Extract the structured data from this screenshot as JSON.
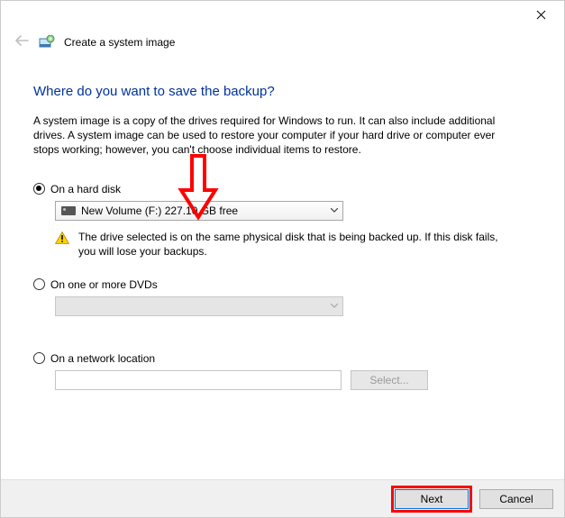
{
  "window": {
    "title": "Create a system image"
  },
  "heading": "Where do you want to save the backup?",
  "description": "A system image is a copy of the drives required for Windows to run. It can also include additional drives. A system image can be used to restore your computer if your hard drive or computer ever stops working; however, you can't choose individual items to restore.",
  "options": {
    "hard_disk": {
      "label": "On a hard disk",
      "selected_drive": "New Volume (F:)  227.10 GB free",
      "warning": "The drive selected is on the same physical disk that is being backed up. If this disk fails, you will lose your backups."
    },
    "dvd": {
      "label": "On one or more DVDs"
    },
    "network": {
      "label": "On a network location",
      "select_button": "Select..."
    }
  },
  "footer": {
    "next": "Next",
    "cancel": "Cancel"
  }
}
